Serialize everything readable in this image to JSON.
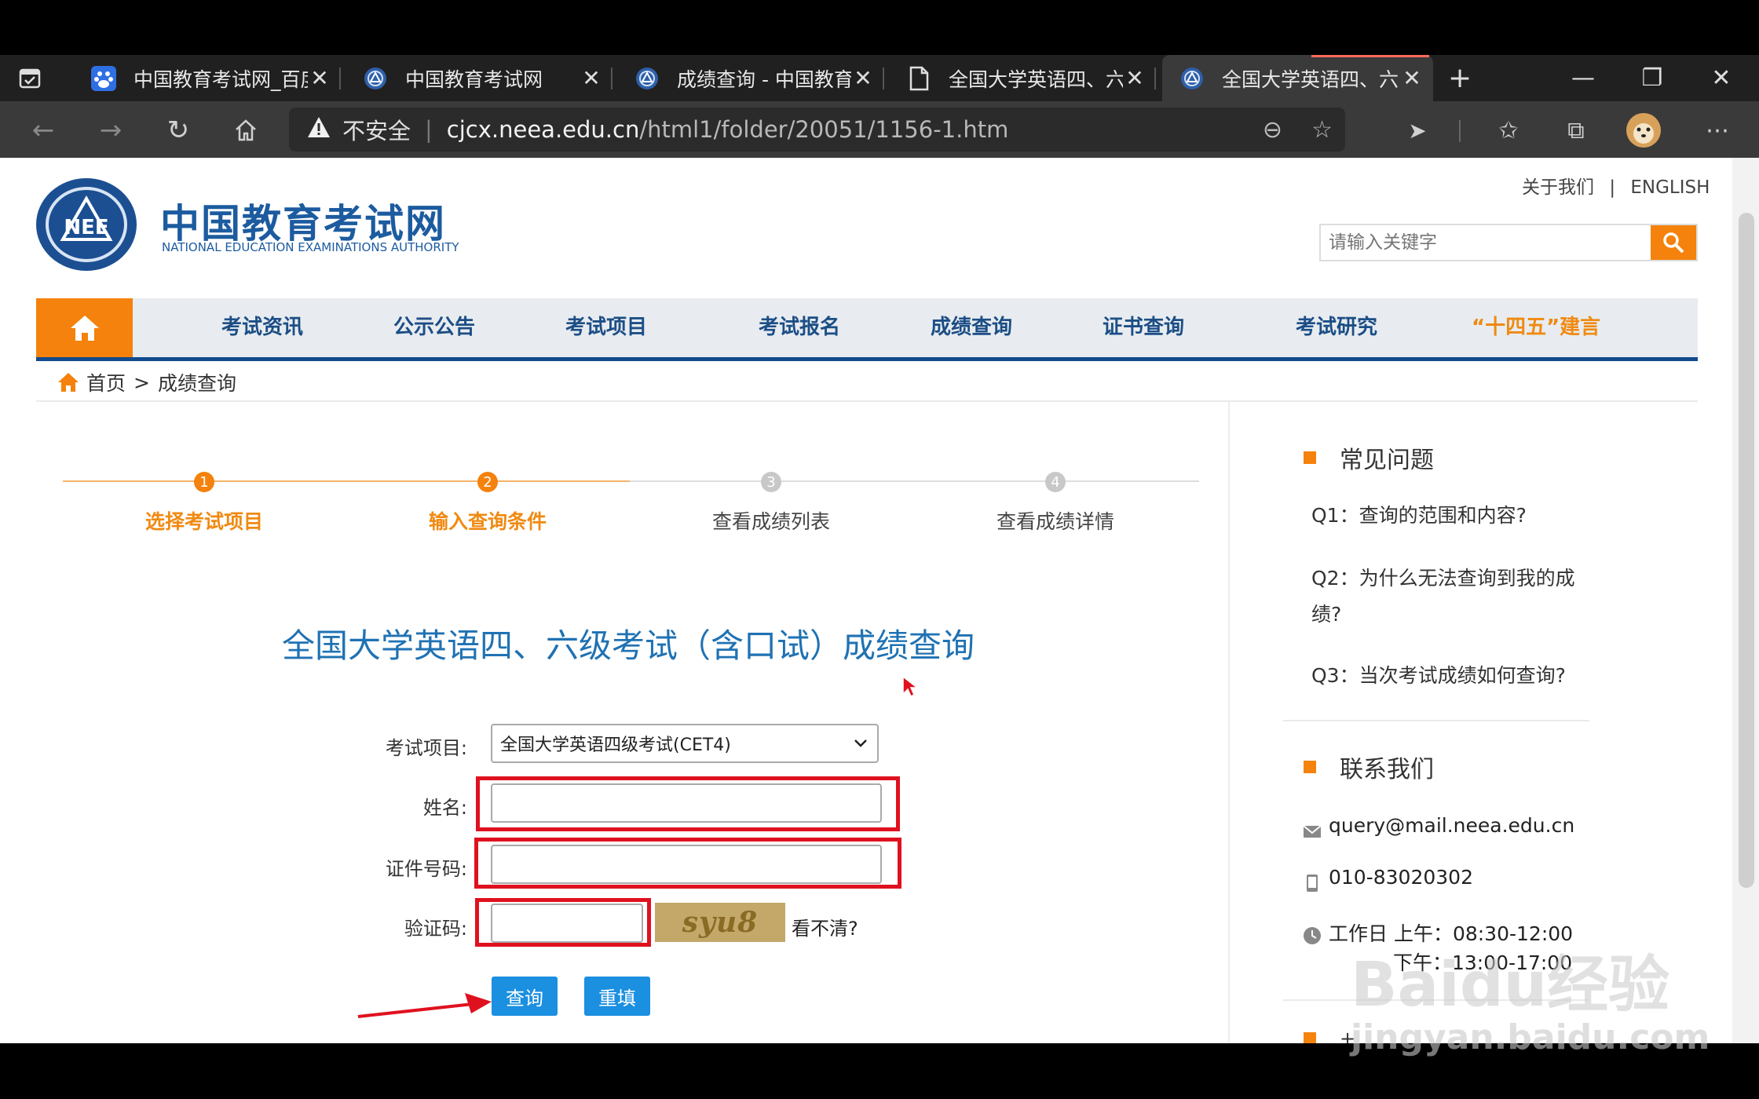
{
  "browser": {
    "tabs": [
      {
        "title": "中国教育考试网_百度",
        "icon": "baidu-icon"
      },
      {
        "title": "中国教育考试网",
        "icon": "neea-icon"
      },
      {
        "title": "成绩查询 - 中国教育",
        "icon": "neea-icon"
      },
      {
        "title": "全国大学英语四、六",
        "icon": "page-icon"
      },
      {
        "title": "全国大学英语四、六",
        "icon": "neea-icon",
        "active": true
      }
    ],
    "security": "不安全",
    "url_host": "cjcx.neea.edu.cn",
    "url_path": "/html1/folder/20051/1156-1.htm"
  },
  "site": {
    "logo_emblem": "NEE",
    "logo_cn": "中国教育考试网",
    "logo_en": "NATIONAL EDUCATION EXAMINATIONS AUTHORITY",
    "about": "关于我们",
    "divider": "|",
    "english": "ENGLISH",
    "search_placeholder": "请输入关键字",
    "nav": [
      "考试资讯",
      "公示公告",
      "考试项目",
      "考试报名",
      "成绩查询",
      "证书查询",
      "考试研究",
      "“十四五”建言"
    ]
  },
  "breadcrumb": {
    "home": "首页",
    "sep": ">",
    "current": "成绩查询"
  },
  "steps": [
    {
      "num": "1",
      "label": "选择考试项目",
      "done": true
    },
    {
      "num": "2",
      "label": "输入查询条件",
      "done": true
    },
    {
      "num": "3",
      "label": "查看成绩列表",
      "done": false
    },
    {
      "num": "4",
      "label": "查看成绩详情",
      "done": false
    }
  ],
  "form": {
    "title": "全国大学英语四、六级考试（含口试）成绩查询",
    "exam_label": "考试项目:",
    "exam_value": "全国大学英语四级考试(CET4)",
    "name_label": "姓名:",
    "name_value": "",
    "id_label": "证件号码:",
    "id_value": "",
    "captcha_label": "验证码:",
    "captcha_value": "",
    "captcha_image_text": "syu8",
    "refresh_captcha": "看不清?",
    "submit": "查询",
    "reset": "重填"
  },
  "sidebar": {
    "faq_title": "常见问题",
    "faqs": [
      "Q1：查询的范围和内容?",
      "Q2：为什么无法查询到我的成绩?",
      "Q3：当次考试成绩如何查询?"
    ],
    "contact_title": "联系我们",
    "email": "query@mail.neea.edu.cn",
    "phone": "010-83020302",
    "hours_am": "工作日 上午：08:30-12:00",
    "hours_pm": "下午：13:00-17:00",
    "more_partial": "+"
  },
  "watermark": {
    "main": "Baidu经验",
    "sub": "jingyan.baidu.com"
  },
  "colors": {
    "accent": "#f4820c",
    "nav_blue": "#124a8c",
    "title_blue": "#1f72b3",
    "button_blue": "#1b8fe0",
    "annotation_red": "#e0111f"
  }
}
